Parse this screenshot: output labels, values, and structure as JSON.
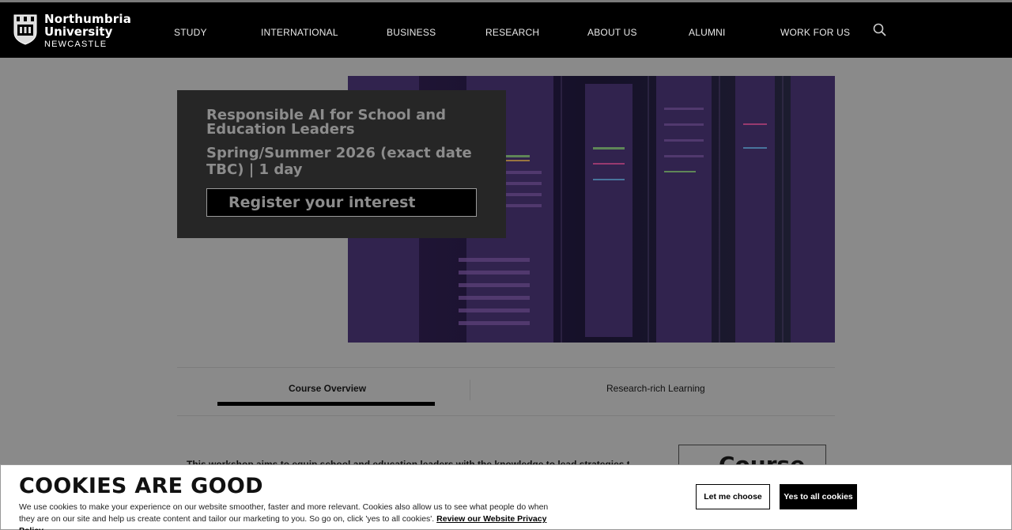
{
  "header": {
    "logo": {
      "line1": "Northumbria",
      "line2": "University",
      "line3": "NEWCASTLE"
    },
    "nav": [
      {
        "label": "STUDY"
      },
      {
        "label": "INTERNATIONAL"
      },
      {
        "label": "BUSINESS"
      },
      {
        "label": "RESEARCH"
      },
      {
        "label": "ABOUT US"
      },
      {
        "label": "ALUMNI"
      },
      {
        "label": "WORK FOR US"
      }
    ],
    "search_icon": "search-icon"
  },
  "hero": {
    "title": "Responsible AI for School and Education Leaders",
    "subtitle": "Spring/Summer 2026 (exact date TBC) | 1 day",
    "register_label": "Register your interest"
  },
  "tabs": [
    {
      "label": "Course Overview",
      "active": true
    },
    {
      "label": "Research-rich Learning",
      "active": false
    }
  ],
  "content": {
    "intro": "This workshop aims to equip school and education leaders with the knowledge to lead strategies to safely",
    "side_box_label": "Course"
  },
  "cookie_banner": {
    "title": "COOKIES ARE GOOD",
    "text": "We use cookies to make your experience on our website smoother, faster and more relevant. Cookies also allow us to see what people do when they are on our site and help us create content and tailor our marketing to you. So go on, click 'yes to all cookies'.",
    "link_label": "Review our Website Privacy Policy",
    "choose_label": "Let me choose",
    "accept_label": "Yes to all cookies"
  },
  "colors": {
    "header_bg": "#000000",
    "overlay": "#8a8a8a",
    "card_bg": "#262626"
  }
}
